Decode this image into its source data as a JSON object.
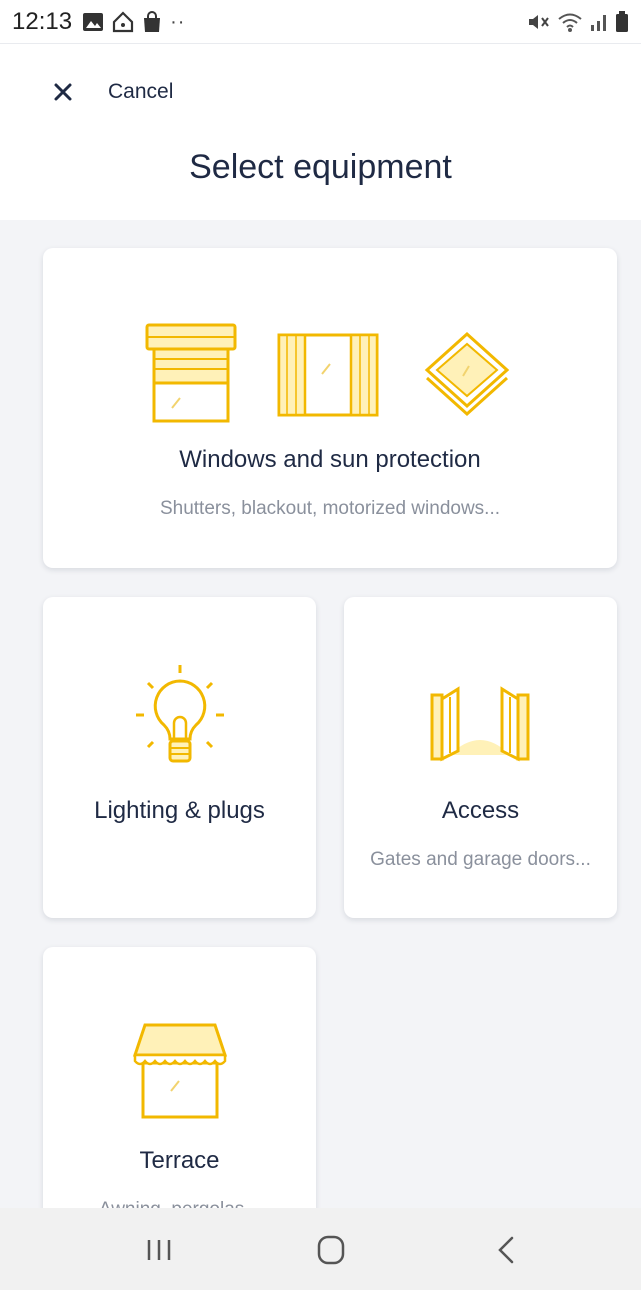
{
  "status_bar": {
    "time": "12:13",
    "left_icons": [
      "gallery-icon",
      "home-icon",
      "bag-icon",
      "more-dots-icon"
    ],
    "right_icons": [
      "mute-icon",
      "wifi-icon",
      "signal-icon",
      "battery-icon"
    ]
  },
  "header": {
    "cancel_label": "Cancel",
    "title": "Select equipment"
  },
  "cards": [
    {
      "title": "Windows and sun protection",
      "subtitle": "Shutters, blackout, motorized windows...",
      "icons": [
        "shutter-icon",
        "curtain-window-icon",
        "skylight-icon"
      ]
    },
    {
      "title": "Lighting & plugs",
      "subtitle": "",
      "icons": [
        "lightbulb-icon"
      ]
    },
    {
      "title": "Access",
      "subtitle": "Gates and garage doors...",
      "icons": [
        "gate-icon"
      ]
    },
    {
      "title": "Terrace",
      "subtitle": "Awning, pergolas...",
      "icons": [
        "awning-icon"
      ]
    }
  ],
  "nav_bar": {
    "buttons": [
      "recent-apps",
      "home",
      "back"
    ]
  },
  "colors": {
    "accent": "#f2b800",
    "text": "#1f2a44",
    "muted": "#8a909c",
    "background": "#f3f4f7"
  }
}
